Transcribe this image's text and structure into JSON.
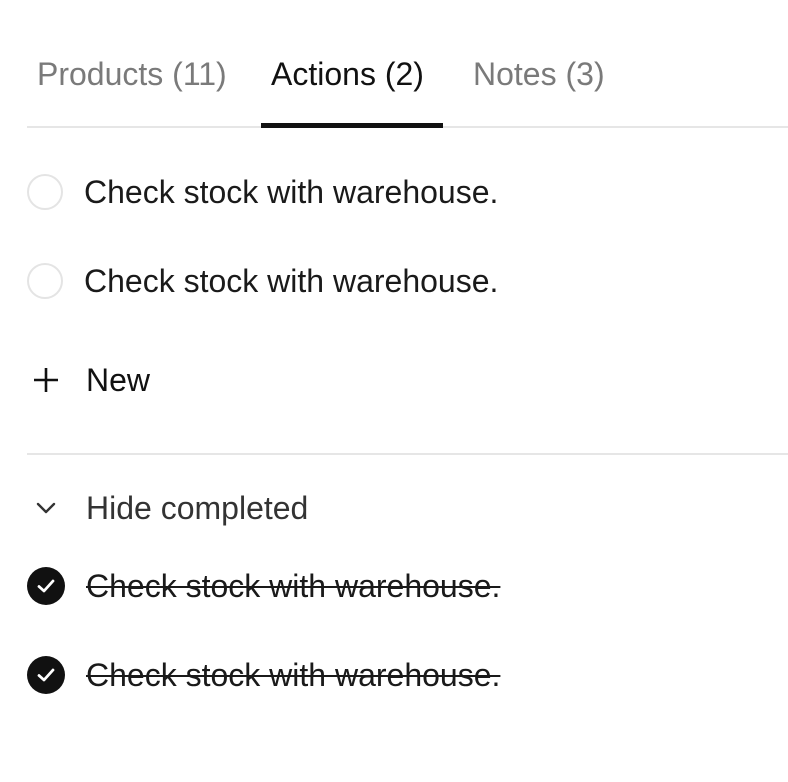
{
  "tabs": [
    {
      "label": "Products (11)",
      "active": false
    },
    {
      "label": "Actions (2)",
      "active": true
    },
    {
      "label": "Notes (3)",
      "active": false
    }
  ],
  "actions": {
    "open": [
      {
        "text": "Check stock with warehouse.",
        "completed": false
      },
      {
        "text": "Check stock with warehouse.",
        "completed": false
      }
    ],
    "new_label": "New",
    "hide_completed_label": "Hide completed",
    "completed": [
      {
        "text": "Check stock with warehouse.",
        "completed": true
      },
      {
        "text": "Check stock with warehouse.",
        "completed": true
      }
    ]
  },
  "icons": {
    "add": "plus-icon",
    "collapse": "chevron-down-icon",
    "checked": "checkmark-circle-icon",
    "unchecked": "empty-circle-icon"
  },
  "colors": {
    "active_tab": "#111111",
    "inactive_tab": "#7a7a7a",
    "divider": "#e6e6e6",
    "checked_fill": "#111111"
  }
}
